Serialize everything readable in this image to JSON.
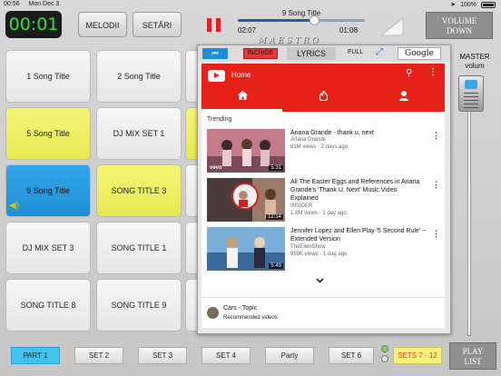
{
  "status": {
    "time": "00:56",
    "date": "Mon Dec 3",
    "battery": "100%"
  },
  "header": {
    "timer": "00:01",
    "melodii": "MELODII",
    "setari": "SETĂRI",
    "track_title": "9 Song Title",
    "elapsed": "02:07",
    "remaining": "01:08",
    "progress": 0.64,
    "brand": "MAESTRO",
    "volume_line1": "VOLUME",
    "volume_line2": "DOWN"
  },
  "pads": [
    {
      "label": "1 Song Title",
      "color": "white"
    },
    {
      "label": "2 Song Title",
      "color": "white"
    },
    {
      "label": "5 Song Title",
      "color": "yellow"
    },
    {
      "label": "DJ MIX SET 1",
      "color": "white"
    },
    {
      "label": "9 Song Title",
      "color": "blue",
      "playing": true
    },
    {
      "label": "SONG TITLE 3",
      "color": "yellow"
    },
    {
      "label": "DJ MIX SET 3",
      "color": "white"
    },
    {
      "label": "SONG TITLE 1",
      "color": "white"
    },
    {
      "label": "SONG TITLE 8",
      "color": "white"
    },
    {
      "label": "SONG TITLE 9",
      "color": "white"
    }
  ],
  "panel": {
    "close": "ÎNCHIDE",
    "lyrics": "LYRICS",
    "full": "FULL",
    "google": "Google",
    "youtube": {
      "home": "Home",
      "section": "Trending",
      "videos": [
        {
          "title": "Ariana Grande - thank u, next",
          "channel": "Ariana Grande",
          "meta": "81M views · 2 days ago",
          "duration": "5:31",
          "badge": "vevo"
        },
        {
          "title": "All The Easter Eggs and References in Ariana Grande's 'Thank U, Next' Music Video Explained",
          "channel": "INSIDER",
          "meta": "1.8M views · 1 day ago",
          "duration": "12:14",
          "badge": ""
        },
        {
          "title": "Jennifer Lopez and Ellen Play '5 Second Rule' -- Extended Version",
          "channel": "TheEllenShow",
          "meta": "959K views · 1 day ago",
          "duration": "5:49",
          "badge": ""
        }
      ],
      "recommended_title": "Cars - Topic",
      "recommended_sub": "Recommended videos"
    }
  },
  "master": {
    "line1": "MASTER",
    "line2": "volum"
  },
  "footer": {
    "part1": "PART 1",
    "set2": "SET 2",
    "set3": "SET 3",
    "set4": "SET 4",
    "party": "Party",
    "set6": "SET 6",
    "sets": "SETS 7 - 12",
    "playlist1": "PLAY",
    "playlist2": "LIST"
  },
  "colors": {
    "accent_blue": "#1e8fd7",
    "pad_yellow": "#f0f060",
    "youtube_red": "#e62117",
    "timer_green": "#33e040",
    "stop_red": "#e0202a"
  }
}
